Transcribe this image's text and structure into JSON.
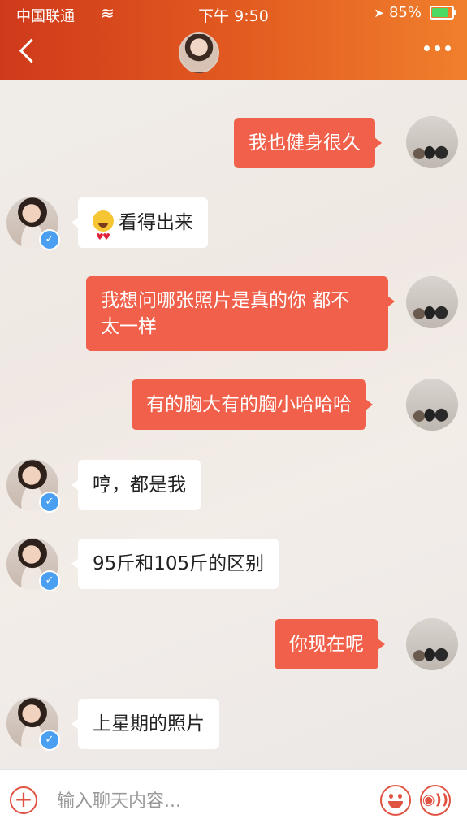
{
  "status_bar": {
    "carrier": "中国联通",
    "time": "下午 9:50",
    "battery": "85%"
  },
  "header": {
    "back_icon": "chevron-left-icon",
    "more_icon": "more-dots-icon"
  },
  "messages": [
    {
      "side": "out",
      "text": "我也健身很久"
    },
    {
      "side": "in",
      "emoji": "heart-eyes",
      "text": "看得出来"
    },
    {
      "side": "out",
      "line1": "我想问哪张照片是真的你 都不",
      "line2": "太一样"
    },
    {
      "side": "out",
      "text": "有的胸大有的胸小哈哈哈"
    },
    {
      "side": "in",
      "text": "哼，都是我"
    },
    {
      "side": "in",
      "text": "95斤和105斤的区别"
    },
    {
      "side": "out",
      "text": "你现在呢"
    },
    {
      "side": "in",
      "text": "上星期的照片"
    }
  ],
  "input_bar": {
    "placeholder": "输入聊天内容...",
    "plus_label": "+",
    "voice_label": "◉))"
  },
  "colors": {
    "header_start": "#cf3a1b",
    "header_end": "#f07f2c",
    "outgoing_bubble": "#f0604a",
    "incoming_bubble": "#ffffff",
    "accent": "#e05242",
    "verify_badge": "#4a9ff0"
  }
}
